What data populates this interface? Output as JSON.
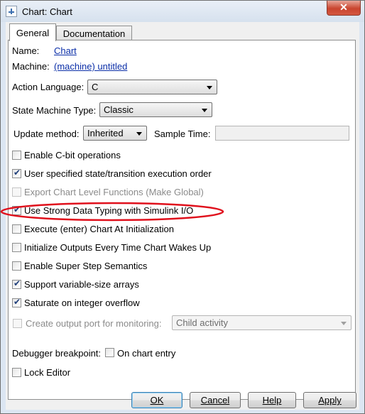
{
  "window": {
    "title": "Chart: Chart",
    "close_glyph": "✕"
  },
  "tabs": [
    {
      "label": "General"
    },
    {
      "label": "Documentation"
    }
  ],
  "general": {
    "name_label": "Name:",
    "name_value": "Chart",
    "machine_label": "Machine:",
    "machine_value": "(machine) untitled",
    "action_language_label": "Action Language:",
    "action_language_value": "C",
    "state_machine_type_label": "State Machine Type:",
    "state_machine_type_value": "Classic",
    "update_method_label": "Update method:",
    "update_method_value": "Inherited",
    "sample_time_label": "Sample Time:",
    "sample_time_value": ""
  },
  "options": [
    {
      "label": "Enable C-bit operations",
      "checked": false,
      "enabled": true
    },
    {
      "label": "User specified state/transition execution order",
      "checked": true,
      "enabled": true
    },
    {
      "label": "Export Chart Level Functions (Make Global)",
      "checked": false,
      "enabled": false
    },
    {
      "label": "Use Strong Data Typing with Simulink I/O",
      "checked": true,
      "enabled": true
    },
    {
      "label": "Execute (enter) Chart At Initialization",
      "checked": false,
      "enabled": true
    },
    {
      "label": "Initialize Outputs Every Time Chart Wakes Up",
      "checked": false,
      "enabled": true
    },
    {
      "label": "Enable Super Step Semantics",
      "checked": false,
      "enabled": true
    },
    {
      "label": "Support variable-size arrays",
      "checked": true,
      "enabled": true
    },
    {
      "label": "Saturate on integer overflow",
      "checked": true,
      "enabled": true
    }
  ],
  "monitoring": {
    "label": "Create output port for monitoring:",
    "checked": false,
    "enabled": false,
    "select_value": "Child activity"
  },
  "debugger": {
    "label": "Debugger breakpoint:",
    "option_label": "On chart entry",
    "checked": false
  },
  "lock_editor": {
    "label": "Lock Editor",
    "checked": false
  },
  "buttons": {
    "ok": "OK",
    "cancel": "Cancel",
    "help": "Help",
    "apply": "Apply"
  },
  "colors": {
    "link": "#0b2fa8",
    "annotation_ellipse": "#e0101c",
    "close_button": "#c9452f"
  }
}
